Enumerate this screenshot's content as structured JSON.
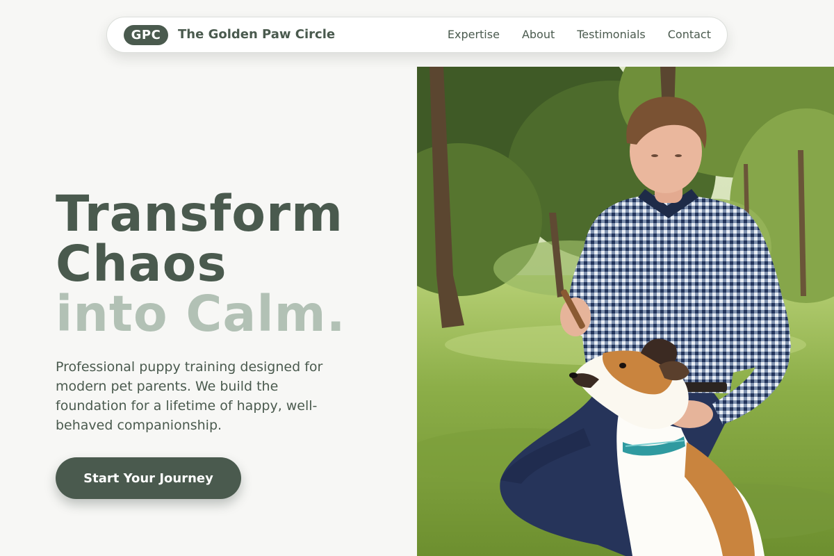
{
  "brand": {
    "initials": "GPC",
    "name": "The Golden Paw Circle"
  },
  "nav": {
    "links": [
      "Expertise",
      "About",
      "Testimonials",
      "Contact"
    ]
  },
  "hero": {
    "headline_line1": "Transform",
    "headline_line2": "Chaos",
    "headline_line3": "into Calm.",
    "lead": "Professional puppy training designed for modern pet parents. We build the foundation for a lifetime of happy, well-behaved companionship.",
    "cta_label": "Start Your Journey"
  },
  "colors": {
    "primary": "#4a5a4e",
    "accent_light": "#b2c1b5",
    "background": "#f7f7f5"
  }
}
